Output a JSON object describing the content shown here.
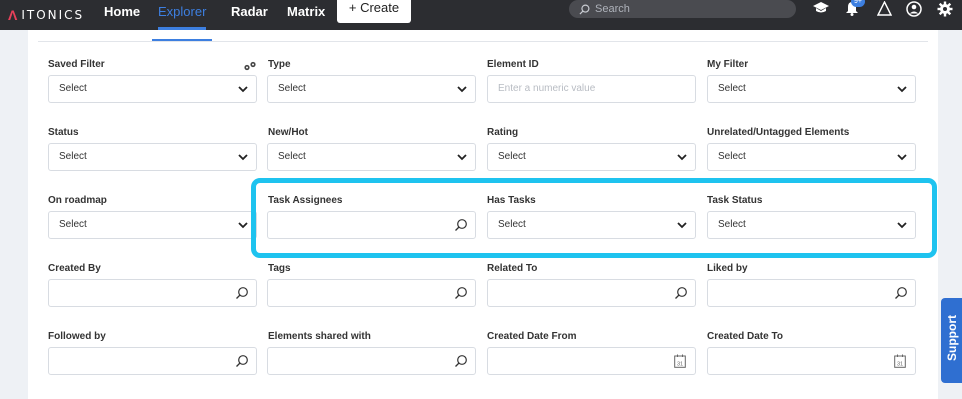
{
  "topbar": {
    "logo_text": "ITONICS",
    "nav": [
      {
        "label": "Home",
        "active": false
      },
      {
        "label": "Explorer",
        "active": true
      },
      {
        "label": "Radar",
        "active": false
      },
      {
        "label": "Matrix",
        "active": false
      }
    ],
    "create_label": "+ Create",
    "search_placeholder": "Search",
    "notification_count": "9+",
    "icons": [
      "graduation-cap-icon",
      "bell-icon",
      "itonics-triangle-icon",
      "user-icon",
      "gear-icon"
    ]
  },
  "filters": {
    "saved_filter": {
      "label": "Saved Filter",
      "value": "Select"
    },
    "type": {
      "label": "Type",
      "value": "Select"
    },
    "element_id": {
      "label": "Element ID",
      "placeholder": "Enter a numeric value"
    },
    "my_filter": {
      "label": "My Filter",
      "value": "Select"
    },
    "status": {
      "label": "Status",
      "value": "Select"
    },
    "new_hot": {
      "label": "New/Hot",
      "value": "Select"
    },
    "rating": {
      "label": "Rating",
      "value": "Select"
    },
    "unrelated": {
      "label": "Unrelated/Untagged Elements",
      "value": "Select"
    },
    "on_roadmap": {
      "label": "On roadmap",
      "value": "Select"
    },
    "task_assignees": {
      "label": "Task Assignees",
      "value": ""
    },
    "has_tasks": {
      "label": "Has Tasks",
      "value": "Select"
    },
    "task_status": {
      "label": "Task Status",
      "value": "Select"
    },
    "created_by": {
      "label": "Created By",
      "value": ""
    },
    "tags": {
      "label": "Tags",
      "value": ""
    },
    "related_to": {
      "label": "Related To",
      "value": ""
    },
    "liked_by": {
      "label": "Liked by",
      "value": ""
    },
    "followed_by": {
      "label": "Followed by",
      "value": ""
    },
    "elements_shared_with": {
      "label": "Elements shared with",
      "value": ""
    },
    "created_date_from": {
      "label": "Created Date From",
      "value": ""
    },
    "created_date_to": {
      "label": "Created Date To",
      "value": ""
    }
  },
  "calendar_day": "31",
  "support_label": "Support",
  "colors": {
    "accent": "#3d7fe0",
    "highlight": "#1ec3ef",
    "topbar": "#2c2d31"
  }
}
